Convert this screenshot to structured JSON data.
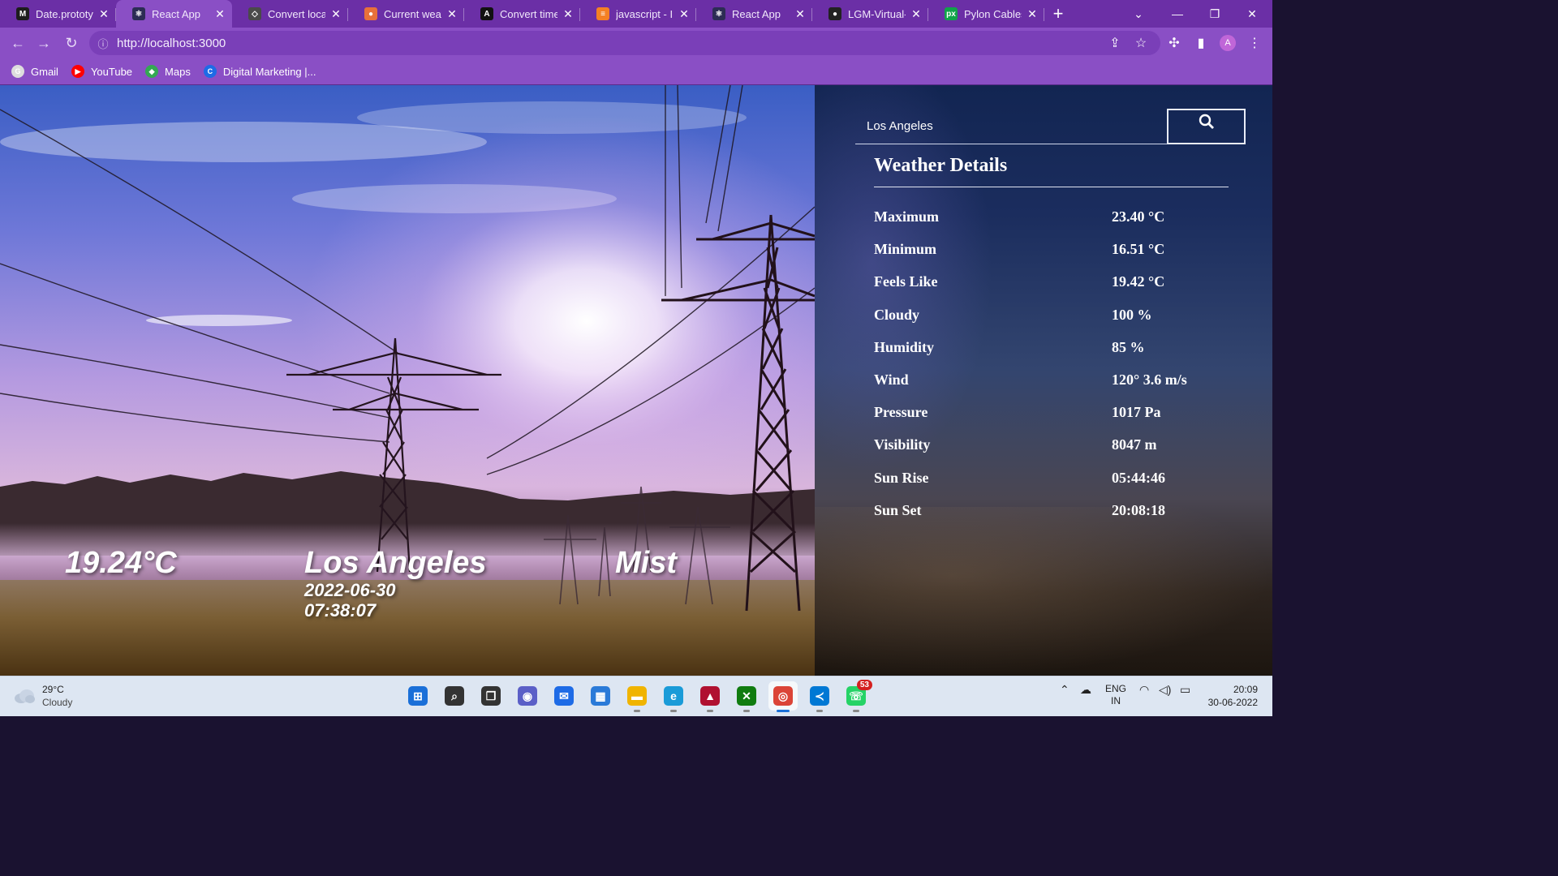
{
  "browser": {
    "tabs": [
      {
        "label": "Date.prototyp",
        "favicon": "m-logo-icon",
        "favicon_glyph": "M",
        "color": "#1d1d1d"
      },
      {
        "label": "React App",
        "favicon": "react-icon",
        "favicon_glyph": "⚛",
        "color": "#2c2c54",
        "active": true
      },
      {
        "label": "Convert local",
        "favicon": "cube-icon",
        "favicon_glyph": "◇",
        "color": "#4a4a4a"
      },
      {
        "label": "Current weath",
        "favicon": "weather-icon",
        "favicon_glyph": "●",
        "color": "#e8703a"
      },
      {
        "label": "Convert timez",
        "favicon": "code-icon",
        "favicon_glyph": "A",
        "color": "#111111"
      },
      {
        "label": "javascript - Inv",
        "favicon": "stackoverflow-icon",
        "favicon_glyph": "≡",
        "color": "#f48024"
      },
      {
        "label": "React App",
        "favicon": "react-icon",
        "favicon_glyph": "⚛",
        "color": "#2c2c54"
      },
      {
        "label": "LGM-Virtual-In",
        "favicon": "github-icon",
        "favicon_glyph": "●",
        "color": "#222222"
      },
      {
        "label": "Pylon Cables S",
        "favicon": "px-icon",
        "favicon_glyph": "px",
        "color": "#11a34a"
      }
    ],
    "url": "http://localhost:3000",
    "bookmarks": [
      {
        "label": "Gmail",
        "icon": "gmail-icon",
        "color": "#dddddd",
        "glyph": "G"
      },
      {
        "label": "YouTube",
        "icon": "youtube-icon",
        "color": "#ff0000",
        "glyph": "▶"
      },
      {
        "label": "Maps",
        "icon": "maps-icon",
        "color": "#34a853",
        "glyph": "◆"
      },
      {
        "label": "Digital Marketing |...",
        "icon": "c-logo-icon",
        "color": "#1e6be6",
        "glyph": "C"
      }
    ],
    "profile_initial": "A"
  },
  "weather": {
    "temperature": "19.24°C",
    "city": "Los Angeles",
    "date": "2022-06-30",
    "time": "07:38:07",
    "condition": "Mist",
    "search_value": "Los Angeles",
    "details_title": "Weather Details",
    "details": [
      {
        "label": "Maximum",
        "value": "23.40 °C"
      },
      {
        "label": "Minimum",
        "value": "16.51 °C"
      },
      {
        "label": "Feels Like",
        "value": "19.42 °C"
      },
      {
        "label": "Cloudy",
        "value": "100 %"
      },
      {
        "label": "Humidity",
        "value": "85 %"
      },
      {
        "label": "Wind",
        "value": "120° 3.6 m/s"
      },
      {
        "label": "Pressure",
        "value": "1017 Pa"
      },
      {
        "label": "Visibility",
        "value": "8047 m"
      },
      {
        "label": "Sun Rise",
        "value": "05:44:46"
      },
      {
        "label": "Sun Set",
        "value": "20:08:18"
      }
    ]
  },
  "taskbar": {
    "weather_temp": "29°C",
    "weather_text": "Cloudy",
    "apps": [
      {
        "name": "start-icon",
        "glyph": "⊞",
        "color": "#1a6fd8"
      },
      {
        "name": "search-icon",
        "glyph": "⌕",
        "color": "#333333"
      },
      {
        "name": "task-view-icon",
        "glyph": "❐",
        "color": "#333333"
      },
      {
        "name": "teams-chat-icon",
        "glyph": "◉",
        "color": "#5b5fc7"
      },
      {
        "name": "mail-icon",
        "glyph": "✉",
        "color": "#1e6be6"
      },
      {
        "name": "store-icon",
        "glyph": "▦",
        "color": "#2a7ad8"
      },
      {
        "name": "file-explorer-icon",
        "glyph": "▬",
        "color": "#f0b400"
      },
      {
        "name": "edge-icon",
        "glyph": "e",
        "color": "#1a9bd8"
      },
      {
        "name": "app-red-icon",
        "glyph": "▲",
        "color": "#b01030"
      },
      {
        "name": "xbox-icon",
        "glyph": "✕",
        "color": "#107c10"
      },
      {
        "name": "chrome-icon",
        "glyph": "◎",
        "color": "#db4437",
        "active": true
      },
      {
        "name": "vscode-icon",
        "glyph": "≺",
        "color": "#0078d4"
      },
      {
        "name": "whatsapp-icon",
        "glyph": "☏",
        "color": "#25d366",
        "badge": "53"
      }
    ],
    "lang_top": "ENG",
    "lang_bottom": "IN",
    "clock_time": "20:09",
    "clock_date": "30-06-2022"
  }
}
